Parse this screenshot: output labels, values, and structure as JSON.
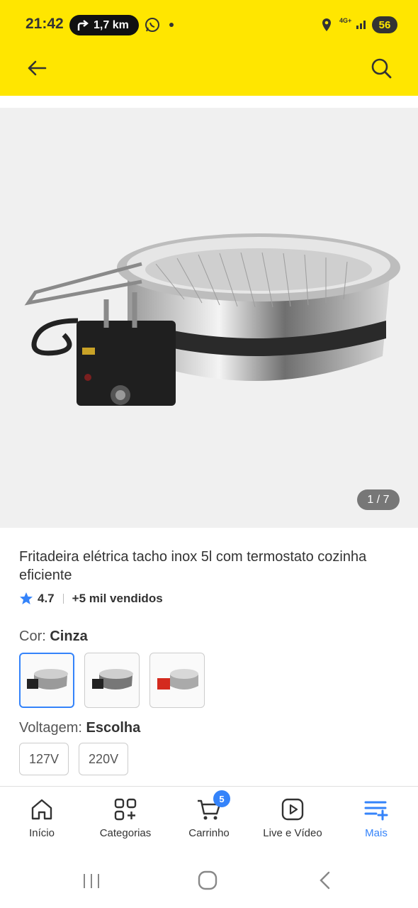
{
  "status_bar": {
    "time": "21:42",
    "navigation_distance": "1,7 km",
    "network": "4G+",
    "battery": "56"
  },
  "gallery": {
    "counter": "1 / 7"
  },
  "product": {
    "title": "Fritadeira elétrica tacho inox 5l com termostato cozinha eficiente",
    "rating": "4.7",
    "sold": "+5 mil vendidos"
  },
  "options": {
    "color_label": "Cor:",
    "color_value": "Cinza",
    "voltage_label": "Voltagem:",
    "voltage_value": "Escolha",
    "voltages": [
      "127V",
      "220V"
    ]
  },
  "tabbar": {
    "items": [
      {
        "label": "Início",
        "icon": "home-icon"
      },
      {
        "label": "Categorias",
        "icon": "categories-icon"
      },
      {
        "label": "Carrinho",
        "icon": "cart-icon",
        "badge": "5"
      },
      {
        "label": "Live e Vídeo",
        "icon": "play-icon"
      },
      {
        "label": "Mais",
        "icon": "more-icon"
      }
    ],
    "active_color": "#3483fa"
  },
  "colors": {
    "header": "#ffe600",
    "accent": "#3483fa"
  }
}
